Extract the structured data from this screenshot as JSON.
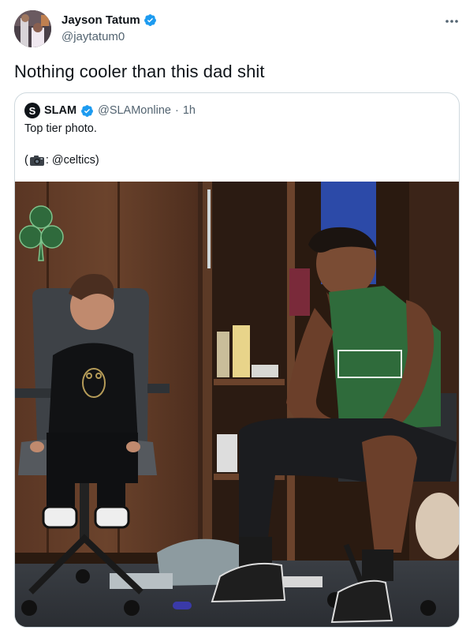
{
  "author": {
    "name": "Jayson Tatum",
    "handle": "@jaytatum0",
    "verified_icon": "verified-badge-icon",
    "avatar": "profile-photo"
  },
  "more_icon": "more-horizontal-icon",
  "tweet": {
    "text": "Nothing cooler than this dad shit"
  },
  "quoted_tweet": {
    "name": "SLAM",
    "logo_letter": "S",
    "handle": "@SLAMonline",
    "separator": "·",
    "time": "1h",
    "line1": "Top tier photo.",
    "line2_prefix": "(",
    "line2_suffix": ": @celtics)",
    "camera_icon": "camera-emoji-icon",
    "photo": "locker-room-photo"
  },
  "colors": {
    "text": "#0f1419",
    "secondary": "#536471",
    "border": "#cfd9de",
    "verified": "#1d9bf0"
  }
}
